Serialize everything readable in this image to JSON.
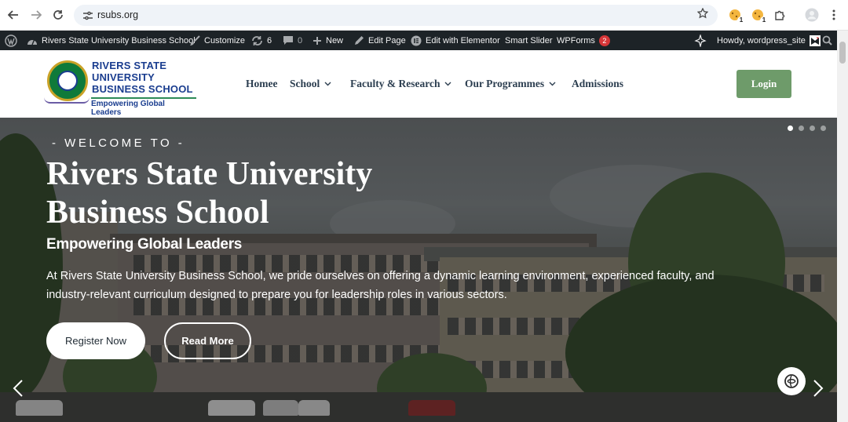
{
  "browser": {
    "url": "rsubs.org",
    "extension_badges": [
      "1",
      "1"
    ]
  },
  "adminbar": {
    "site_name": "Rivers State University Business School",
    "customize": "Customize",
    "updates_count": "6",
    "comments_count": "0",
    "new": "New",
    "edit_page": "Edit Page",
    "edit_elementor": "Edit with Elementor",
    "smart_slider": "Smart Slider",
    "wpforms": "WPForms",
    "wpforms_count": "2",
    "howdy": "Howdy, wordpress_site"
  },
  "header": {
    "logo_line1": "RIVERS STATE",
    "logo_line2": "UNIVERSITY",
    "logo_line3": "BUSINESS SCHOOL",
    "logo_tagline": "Empowering Global Leaders",
    "menu": [
      "Homee",
      "School",
      "Faculty & Research",
      "Our Programmes",
      "Admissions"
    ],
    "login": "Login"
  },
  "hero": {
    "welcome": "- WELCOME TO -",
    "title_line1": "Rivers State University",
    "title_line2": "Business School",
    "subtitle": "Empowering Global Leaders",
    "description": "At Rivers State University Business School, we pride ourselves on offering a dynamic learning environment, experienced faculty, and industry-relevant curriculum designed to prepare you for leadership roles in various sectors.",
    "register_label": "Register Now",
    "readmore_label": "Read More",
    "slide_count": 4,
    "active_slide": 1
  },
  "colors": {
    "adminbar_bg": "#1d2327",
    "brand_blue": "#1a3d8f",
    "brand_green": "#0f7a3a",
    "login_green": "#6e9b6a",
    "badge_red": "#d63638"
  },
  "icons": {
    "back": "arrow-left-icon",
    "forward": "arrow-right-icon",
    "reload": "reload-icon",
    "site_settings": "tune-icon",
    "bookmark": "star-icon",
    "extensions": "puzzle-icon",
    "profile": "avatar-icon",
    "menu": "kebab-icon"
  }
}
